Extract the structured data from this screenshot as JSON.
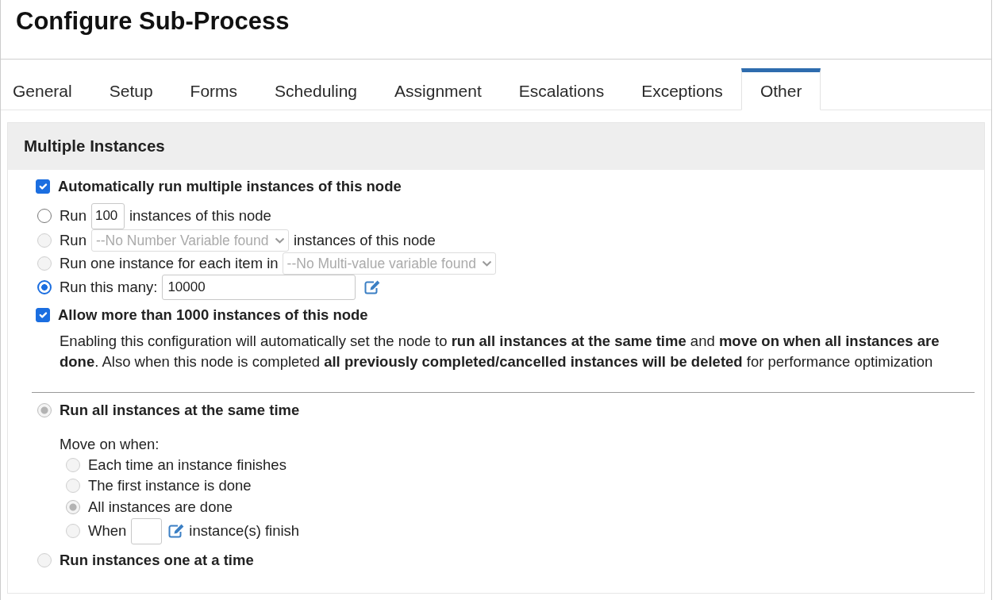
{
  "window": {
    "title": "Configure Sub-Process"
  },
  "tabs": [
    {
      "label": "General",
      "selected": false
    },
    {
      "label": "Setup",
      "selected": false
    },
    {
      "label": "Forms",
      "selected": false
    },
    {
      "label": "Scheduling",
      "selected": false
    },
    {
      "label": "Assignment",
      "selected": false
    },
    {
      "label": "Escalations",
      "selected": false
    },
    {
      "label": "Exceptions",
      "selected": false
    },
    {
      "label": "Other",
      "selected": true
    }
  ],
  "panel": {
    "title": "Multiple Instances"
  },
  "auto_run": {
    "label": "Automatically run multiple instances of this node",
    "checked": true
  },
  "count_options": [
    {
      "kind": "input",
      "before": "Run",
      "value": "100",
      "after": "instances of this node",
      "selected": false,
      "disabled": false
    },
    {
      "kind": "select",
      "before": "Run",
      "value": "--No Number Variable found",
      "after": "instances of this node",
      "selected": false,
      "disabled": true
    },
    {
      "kind": "select",
      "before": "Run one instance for each item in",
      "value": "--No Multi-value variable found",
      "selected": false,
      "disabled": true
    },
    {
      "kind": "expression",
      "before": "Run this many:",
      "value": "10000",
      "selected": true,
      "disabled": false
    }
  ],
  "allow_over_1000": {
    "label": "Allow more than 1000 instances of this node",
    "checked": true,
    "note": "Enabling this configuration will automatically set the node to **run all instances at the same time** and **move on when all instances are done**. Also when this node is completed **all previously completed/cancelled instances will be deleted** for performance optimization"
  },
  "execution_modes": [
    {
      "label": "Run all instances at the same time",
      "selected": true,
      "disabled": true,
      "move_on": {
        "label": "Move on when:",
        "options": [
          {
            "kind": "plain",
            "label": "Each time an instance finishes",
            "selected": false,
            "disabled": true
          },
          {
            "kind": "plain",
            "label": "The first instance is done",
            "selected": false,
            "disabled": true
          },
          {
            "kind": "plain",
            "label": "All instances are done",
            "selected": true,
            "disabled": true
          },
          {
            "kind": "expression",
            "before": "When",
            "after": "instance(s) finish",
            "selected": false,
            "disabled": true
          }
        ]
      }
    },
    {
      "label": "Run instances one at a time",
      "selected": false,
      "disabled": true
    }
  ]
}
